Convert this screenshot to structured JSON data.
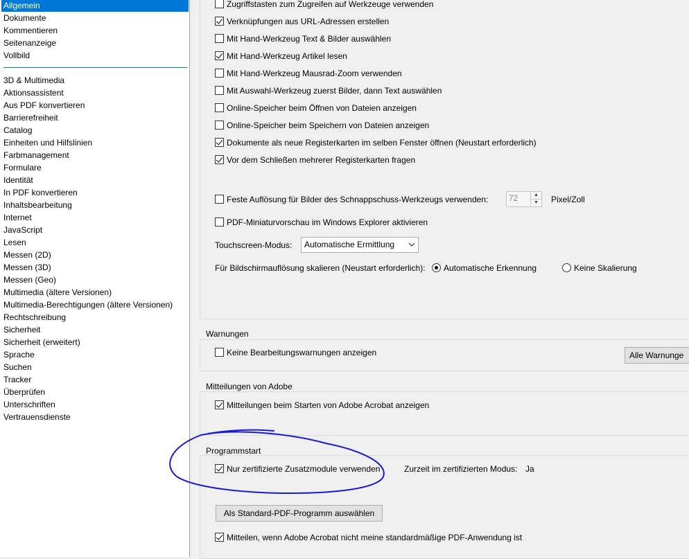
{
  "sidebar": {
    "items": [
      "Allgemein",
      "Dokumente",
      "Kommentieren",
      "Seitenanzeige",
      "Vollbild",
      "3D & Multimedia",
      "Aktionsassistent",
      "Aus PDF konvertieren",
      "Barrierefreiheit",
      "Catalog",
      "Einheiten und Hilfslinien",
      "Farbmanagement",
      "Formulare",
      "Identität",
      "In PDF konvertieren",
      "Inhaltsbearbeitung",
      "Internet",
      "JavaScript",
      "Lesen",
      "Messen (2D)",
      "Messen (3D)",
      "Messen (Geo)",
      "Multimedia (ältere Versionen)",
      "Multimedia-Berechtigungen (ältere Versionen)",
      "Rechtschreibung",
      "Sicherheit",
      "Sicherheit (erweitert)",
      "Sprache",
      "Suchen",
      "Tracker",
      "Überprüfen",
      "Unterschriften",
      "Vertrauensdienste"
    ],
    "selected_index": 0
  },
  "general": {
    "options": [
      {
        "label": "Zugriffstasten zum Zugreifen auf Werkzeuge verwenden",
        "checked": false
      },
      {
        "label": "Verknüpfungen aus URL-Adressen erstellen",
        "checked": true
      },
      {
        "label": "Mit Hand-Werkzeug Text & Bilder auswählen",
        "checked": false
      },
      {
        "label": "Mit Hand-Werkzeug Artikel lesen",
        "checked": true
      },
      {
        "label": "Mit Hand-Werkzeug Mausrad-Zoom verwenden",
        "checked": false
      },
      {
        "label": "Mit Auswahl-Werkzeug zuerst Bilder, dann Text auswählen",
        "checked": false
      },
      {
        "label": "Online-Speicher beim Öffnen von Dateien anzeigen",
        "checked": false
      },
      {
        "label": "Online-Speicher beim Speichern von Dateien anzeigen",
        "checked": false
      },
      {
        "label": "Dokumente als neue Registerkarten im selben Fenster öffnen (Neustart erforderlich)",
        "checked": true
      },
      {
        "label": "Vor dem Schließen mehrerer Registerkarten fragen",
        "checked": true
      }
    ],
    "fixed_resolution": {
      "label": "Feste Auflösung für Bilder des Schnappschuss-Werkzeugs verwenden:",
      "checked": false,
      "value": "72",
      "unit": "Pixel/Zoll"
    },
    "thumbnail_preview": {
      "label": "PDF-Miniaturvorschau im Windows Explorer aktivieren",
      "checked": false
    },
    "touchscreen": {
      "label": "Touchscreen-Modus:",
      "value": "Automatische Ermittlung"
    },
    "scaling": {
      "label": "Für Bildschirmauflösung skalieren (Neustart erforderlich):",
      "options": [
        {
          "label": "Automatische Erkennung",
          "checked": true
        },
        {
          "label": "Keine Skalierung",
          "checked": false
        }
      ]
    }
  },
  "warnings": {
    "title": "Warnungen",
    "option": {
      "label": "Keine Bearbeitungswarnungen anzeigen",
      "checked": false
    },
    "reset_button": "Alle Warnunge"
  },
  "adobe_messages": {
    "title": "Mitteilungen von Adobe",
    "option": {
      "label": "Mitteilungen beim Starten von Adobe Acrobat anzeigen",
      "checked": true
    }
  },
  "startup": {
    "title": "Programmstart",
    "certified_plugins": {
      "label": "Nur zertifizierte Zusatzmodule verwenden",
      "checked": true
    },
    "certified_mode_label": "Zurzeit im zertifizierten Modus:",
    "certified_mode_value": "Ja",
    "default_button": "Als Standard-PDF-Programm auswählen",
    "notify": {
      "label": "Mitteilen, wenn Adobe Acrobat nicht meine standardmäßige PDF-Anwendung ist",
      "checked": true
    }
  },
  "colors": {
    "selection": "#0078d7",
    "annotation": "#1a1ad6"
  }
}
